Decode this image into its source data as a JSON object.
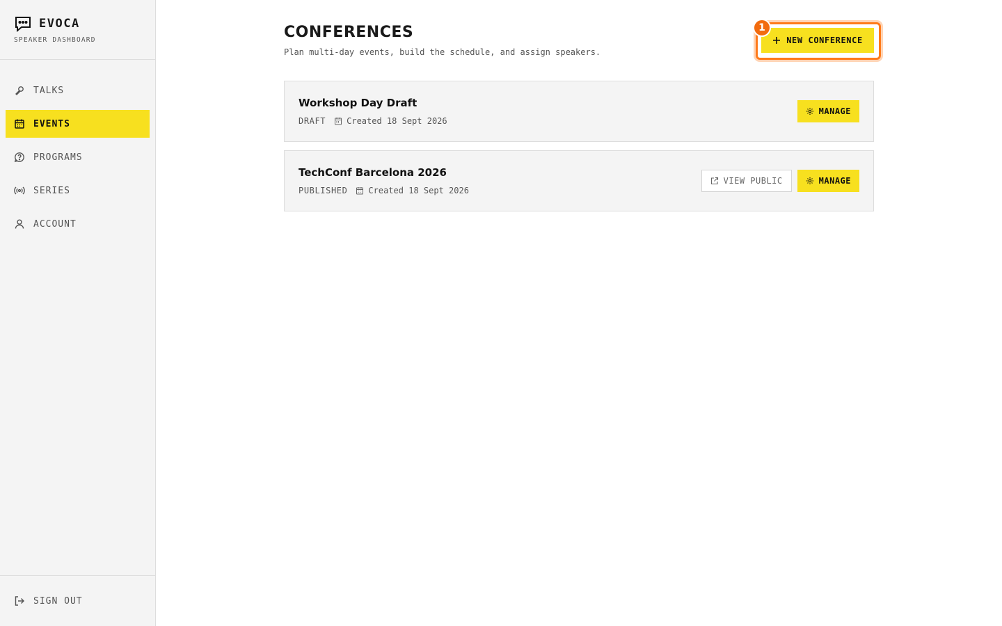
{
  "brand": {
    "name": "EVOCA",
    "subtitle": "SPEAKER DASHBOARD",
    "icon": "chat-bubble-icon"
  },
  "nav": {
    "items": [
      {
        "label": "TALKS",
        "icon": "microphone-icon",
        "active": false
      },
      {
        "label": "EVENTS",
        "icon": "calendar-icon",
        "active": true
      },
      {
        "label": "PROGRAMS",
        "icon": "help-circle-icon",
        "active": false
      },
      {
        "label": "SERIES",
        "icon": "broadcast-icon",
        "active": false
      },
      {
        "label": "ACCOUNT",
        "icon": "user-icon",
        "active": false
      }
    ],
    "sign_out": "SIGN OUT"
  },
  "header": {
    "title": "CONFERENCES",
    "subtitle": "Plan multi-day events, build the schedule, and assign speakers.",
    "new_button": "NEW CONFERENCE",
    "highlight_badge": "1"
  },
  "conferences": [
    {
      "title": "Workshop Day Draft",
      "status": "DRAFT",
      "created": "Created 18 Sept 2026",
      "manage_label": "MANAGE"
    },
    {
      "title": "TechConf Barcelona 2026",
      "status": "PUBLISHED",
      "created": "Created 18 Sept 2026",
      "view_public_label": "VIEW PUBLIC",
      "manage_label": "MANAGE"
    }
  ],
  "colors": {
    "accent": "#f7e01f",
    "highlight": "#ff7a1a",
    "badge": "#f26b0f",
    "sidebar_bg": "#f4f4f4"
  }
}
